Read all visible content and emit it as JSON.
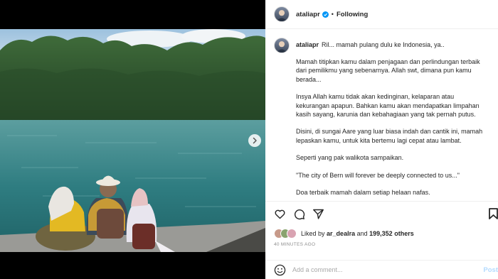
{
  "post": {
    "username": "ataliapr",
    "follow_status": "Following",
    "separator": "•",
    "caption_first": "Ril... mamah pulang dulu ke Indonesia, ya..",
    "caption_paragraphs": [
      "Mamah titipkan kamu dalam penjagaan dan perlindungan terbaik dari pemilikmu yang sebenarnya. Allah swt, dimana pun kamu berada...",
      "Insya Allah kamu tidak akan kedinginan, kelaparan atau kekurangan apapun. Bahkan kamu akan mendapatkan limpahan kasih sayang, karunia dan kebahagiaan yang tak pernah putus.",
      "Disini, di sungai Aare yang luar biasa indah dan cantik ini, mamah lepaskan kamu, untuk kita bertemu lagi cepat atau lambat.",
      "Seperti yang pak walikota sampaikan.",
      "\"The city of Bern will forever be deeply connected to us...\"",
      "Doa terbaik mamah dalam setiap helaan nafas."
    ],
    "likes": {
      "prefix": "Liked by",
      "user": "ar_dealra",
      "middle": "and",
      "count": "199,352",
      "suffix": "others"
    },
    "timestamp": "40 MINUTES AGO",
    "comment_placeholder": "Add a comment...",
    "post_label": "Post"
  },
  "icons": {
    "like": "heart-icon",
    "comment": "comment-icon",
    "share": "share-icon",
    "save": "bookmark-icon",
    "emoji": "emoji-icon",
    "verified": "verified-badge-icon",
    "next": "chevron-right-icon"
  },
  "colors": {
    "verified_blue": "#0095f6",
    "post_button": "#b3dbff",
    "timestamp": "#8e8e8e"
  }
}
